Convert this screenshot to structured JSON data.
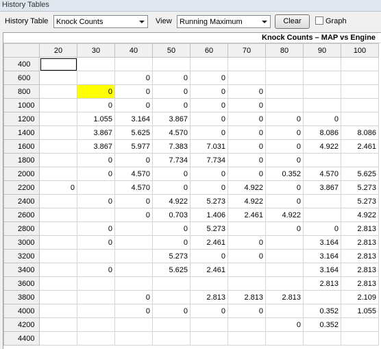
{
  "window": {
    "title": "History Tables"
  },
  "toolbar": {
    "history_label": "History Table",
    "history_value": "Knock Counts",
    "view_label": "View",
    "view_value": "Running Maximum",
    "clear_label": "Clear",
    "graph_label": "Graph",
    "graph_checked": false
  },
  "table": {
    "caption": "Knock Counts – MAP vs Engine",
    "columns": [
      "20",
      "30",
      "40",
      "50",
      "60",
      "70",
      "80",
      "90",
      "100"
    ],
    "rows": [
      {
        "label": "400",
        "cells": [
          "",
          "",
          "",
          "",
          "",
          "",
          "",
          "",
          ""
        ]
      },
      {
        "label": "600",
        "cells": [
          "",
          "",
          "0",
          "0",
          "0",
          "",
          "",
          "",
          ""
        ]
      },
      {
        "label": "800",
        "cells": [
          "",
          "0",
          "0",
          "0",
          "0",
          "0",
          "",
          "",
          ""
        ]
      },
      {
        "label": "1000",
        "cells": [
          "",
          "0",
          "0",
          "0",
          "0",
          "0",
          "",
          "",
          ""
        ]
      },
      {
        "label": "1200",
        "cells": [
          "",
          "1.055",
          "3.164",
          "3.867",
          "0",
          "0",
          "0",
          "0",
          ""
        ]
      },
      {
        "label": "1400",
        "cells": [
          "",
          "3.867",
          "5.625",
          "4.570",
          "0",
          "0",
          "0",
          "8.086",
          "8.086"
        ]
      },
      {
        "label": "1600",
        "cells": [
          "",
          "3.867",
          "5.977",
          "7.383",
          "7.031",
          "0",
          "0",
          "4.922",
          "2.461"
        ]
      },
      {
        "label": "1800",
        "cells": [
          "",
          "0",
          "0",
          "7.734",
          "7.734",
          "0",
          "0",
          "",
          ""
        ]
      },
      {
        "label": "2000",
        "cells": [
          "",
          "0",
          "4.570",
          "0",
          "0",
          "0",
          "0.352",
          "4.570",
          "5.625"
        ]
      },
      {
        "label": "2200",
        "cells": [
          "0",
          "",
          "4.570",
          "0",
          "0",
          "4.922",
          "0",
          "3.867",
          "5.273"
        ]
      },
      {
        "label": "2400",
        "cells": [
          "",
          "0",
          "0",
          "4.922",
          "5.273",
          "4.922",
          "0",
          "",
          "5.273"
        ]
      },
      {
        "label": "2600",
        "cells": [
          "",
          "",
          "0",
          "0.703",
          "1.406",
          "2.461",
          "4.922",
          "",
          "4.922"
        ]
      },
      {
        "label": "2800",
        "cells": [
          "",
          "0",
          "",
          "0",
          "5.273",
          "",
          "0",
          "0",
          "2.813"
        ]
      },
      {
        "label": "3000",
        "cells": [
          "",
          "0",
          "",
          "0",
          "2.461",
          "0",
          "",
          "3.164",
          "2.813"
        ]
      },
      {
        "label": "3200",
        "cells": [
          "",
          "",
          "",
          "5.273",
          "0",
          "0",
          "",
          "3.164",
          "2.813"
        ]
      },
      {
        "label": "3400",
        "cells": [
          "",
          "0",
          "",
          "5.625",
          "2.461",
          "",
          "",
          "3.164",
          "2.813"
        ]
      },
      {
        "label": "3600",
        "cells": [
          "",
          "",
          "",
          "",
          "",
          "",
          "",
          "2.813",
          "2.813"
        ]
      },
      {
        "label": "3800",
        "cells": [
          "",
          "",
          "0",
          "",
          "2.813",
          "2.813",
          "2.813",
          "",
          "2.109"
        ]
      },
      {
        "label": "4000",
        "cells": [
          "",
          "",
          "0",
          "0",
          "0",
          "0",
          "",
          "0.352",
          "1.055"
        ]
      },
      {
        "label": "4200",
        "cells": [
          "",
          "",
          "",
          "",
          "",
          "",
          "0",
          "0.352",
          ""
        ]
      },
      {
        "label": "4400",
        "cells": [
          "",
          "",
          "",
          "",
          "",
          "",
          "",
          "",
          ""
        ]
      }
    ],
    "selected_cell": {
      "row": 0,
      "col": 0
    },
    "highlight_cell": {
      "row": 2,
      "col": 1
    },
    "highlight_color": "#ffff00"
  }
}
